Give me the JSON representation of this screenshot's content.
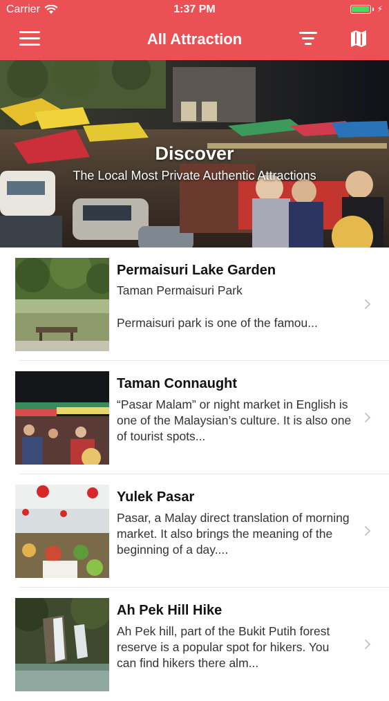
{
  "status_bar": {
    "carrier": "Carrier",
    "time": "1:37 PM",
    "battery_color": "#4cd964"
  },
  "nav": {
    "title": "All Attraction",
    "background": "#ea5054",
    "icons": [
      "menu-icon",
      "filter-icon",
      "map-icon"
    ]
  },
  "hero": {
    "title": "Discover",
    "subtitle": "The Local Most Private Authentic Attractions"
  },
  "attractions": [
    {
      "title": "Permaisuri Lake Garden",
      "subtitle": "Taman Permaisuri Park",
      "description": "Permaisuri park is one of the famou..."
    },
    {
      "title": "Taman Connaught",
      "description": "“Pasar Malam” or night market in English is one of the Malaysian’s culture. It is also one of tourist spots..."
    },
    {
      "title": "Yulek Pasar",
      "description": "Pasar, a Malay direct translation of morning market. It also brings the meaning of the beginning of a day...."
    },
    {
      "title": "Ah Pek Hill Hike",
      "description": "Ah Pek hill, part of the Bukit Putih forest reserve is a popular spot for hikers. You can find hikers there alm..."
    }
  ]
}
